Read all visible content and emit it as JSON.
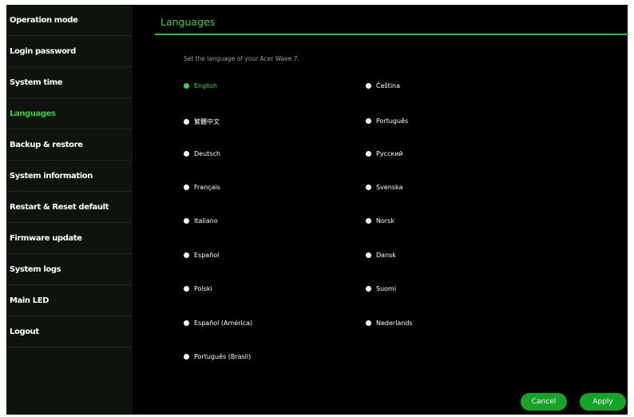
{
  "sidebar": {
    "items": [
      {
        "label": "Operation mode"
      },
      {
        "label": "Login password"
      },
      {
        "label": "System time"
      },
      {
        "label": "Languages"
      },
      {
        "label": "Backup & restore"
      },
      {
        "label": "System information"
      },
      {
        "label": "Restart & Reset default"
      },
      {
        "label": "Firmware update"
      },
      {
        "label": "System logs"
      },
      {
        "label": "Main LED"
      },
      {
        "label": "Logout"
      }
    ],
    "active_index": 3
  },
  "main": {
    "title": "Languages",
    "hint": "Set the language of your Acer Wave 7.",
    "languages": [
      {
        "label": "English",
        "selected": true
      },
      {
        "label": "Čeština"
      },
      {
        "label": "繁體中文"
      },
      {
        "label": "Português"
      },
      {
        "label": "Deutsch"
      },
      {
        "label": "Русский"
      },
      {
        "label": "Français"
      },
      {
        "label": "Svenska"
      },
      {
        "label": "Italiano"
      },
      {
        "label": "Norsk"
      },
      {
        "label": "Español"
      },
      {
        "label": "Dansk"
      },
      {
        "label": "Polski"
      },
      {
        "label": "Suomi"
      },
      {
        "label": "Español (América)"
      },
      {
        "label": "Nederlands"
      },
      {
        "label": "Português (Brasil)"
      }
    ]
  },
  "buttons": {
    "cancel_label": "Cancel",
    "apply_label": "Apply"
  },
  "colors": {
    "accent": "#2ecc40",
    "button": "#16a32a",
    "background": "#000000",
    "sidebar": "#0e130e"
  }
}
